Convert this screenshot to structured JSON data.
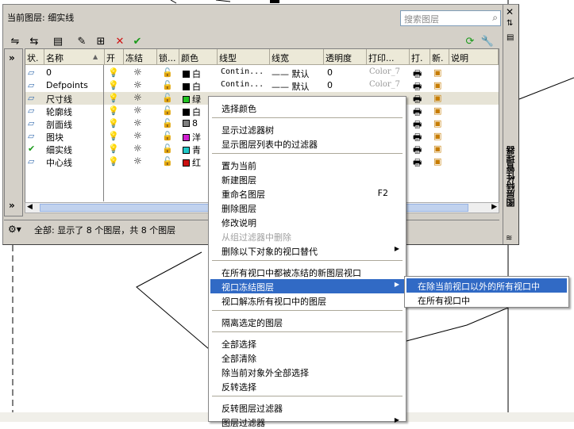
{
  "palette": {
    "current_layer": "当前图层: 细实线",
    "search_placeholder": "搜索图层",
    "vertical_title": "图层特性管理器",
    "status_text": "全部: 显示了 8 个图层，共 8 个图层"
  },
  "columns": [
    "状.",
    "名称",
    "开",
    "冻结",
    "锁...",
    "颜色",
    "线型",
    "线宽",
    "透明度",
    "打印...",
    "打.",
    "新.",
    "说明"
  ],
  "layers": [
    {
      "status": "",
      "name": "0",
      "color_name": "白",
      "color": "#000000",
      "linetype": "Contin...",
      "lineweight": "—— 默认",
      "transparency": "0",
      "plotstyle": "Color_7"
    },
    {
      "status": "",
      "name": "Defpoints",
      "color_name": "白",
      "color": "#000000",
      "linetype": "Contin...",
      "lineweight": "—— 默认",
      "transparency": "0",
      "plotstyle": "Color_7"
    },
    {
      "status": "",
      "name": "尺寸线",
      "color_name": "绿",
      "color": "#22c322",
      "linetype": "",
      "lineweight": "",
      "transparency": "",
      "plotstyle": ""
    },
    {
      "status": "",
      "name": "轮廓线",
      "color_name": "白",
      "color": "#000000",
      "linetype": "",
      "lineweight": "",
      "transparency": "",
      "plotstyle": ""
    },
    {
      "status": "",
      "name": "剖面线",
      "color_name": "8",
      "color": "#808080",
      "linetype": "",
      "lineweight": "",
      "transparency": "",
      "plotstyle": ""
    },
    {
      "status": "",
      "name": "图块",
      "color_name": "洋",
      "color": "#d020d0",
      "linetype": "",
      "lineweight": "",
      "transparency": "",
      "plotstyle": ""
    },
    {
      "status": "✔",
      "name": "细实线",
      "color_name": "青",
      "color": "#20c8c8",
      "linetype": "",
      "lineweight": "",
      "transparency": "",
      "plotstyle": ""
    },
    {
      "status": "",
      "name": "中心线",
      "color_name": "红",
      "color": "#cc1010",
      "linetype": "",
      "lineweight": "",
      "transparency": "",
      "plotstyle": ""
    }
  ],
  "context_menu": {
    "items": [
      "选择颜色",
      "显示过滤器树",
      "显示图层列表中的过滤器",
      "置为当前",
      "新建图层",
      "重命名图层",
      "删除图层",
      "修改说明",
      "从组过滤器中删除",
      "删除以下对象的视口替代",
      "在所有视口中都被冻结的新图层视口",
      "视口冻结图层",
      "视口解冻所有视口中的图层",
      "隔离选定的图层",
      "全部选择",
      "全部清除",
      "除当前对象外全部选择",
      "反转选择",
      "反转图层过滤器",
      "图层过滤器"
    ],
    "rename_shortcut": "F2"
  },
  "submenu": {
    "items": [
      "在除当前视口以外的所有视口中",
      "在所有视口中"
    ]
  },
  "icons": {
    "bulb": "💡",
    "sun": "☼",
    "lock": "🔓",
    "printer": "🖶"
  }
}
